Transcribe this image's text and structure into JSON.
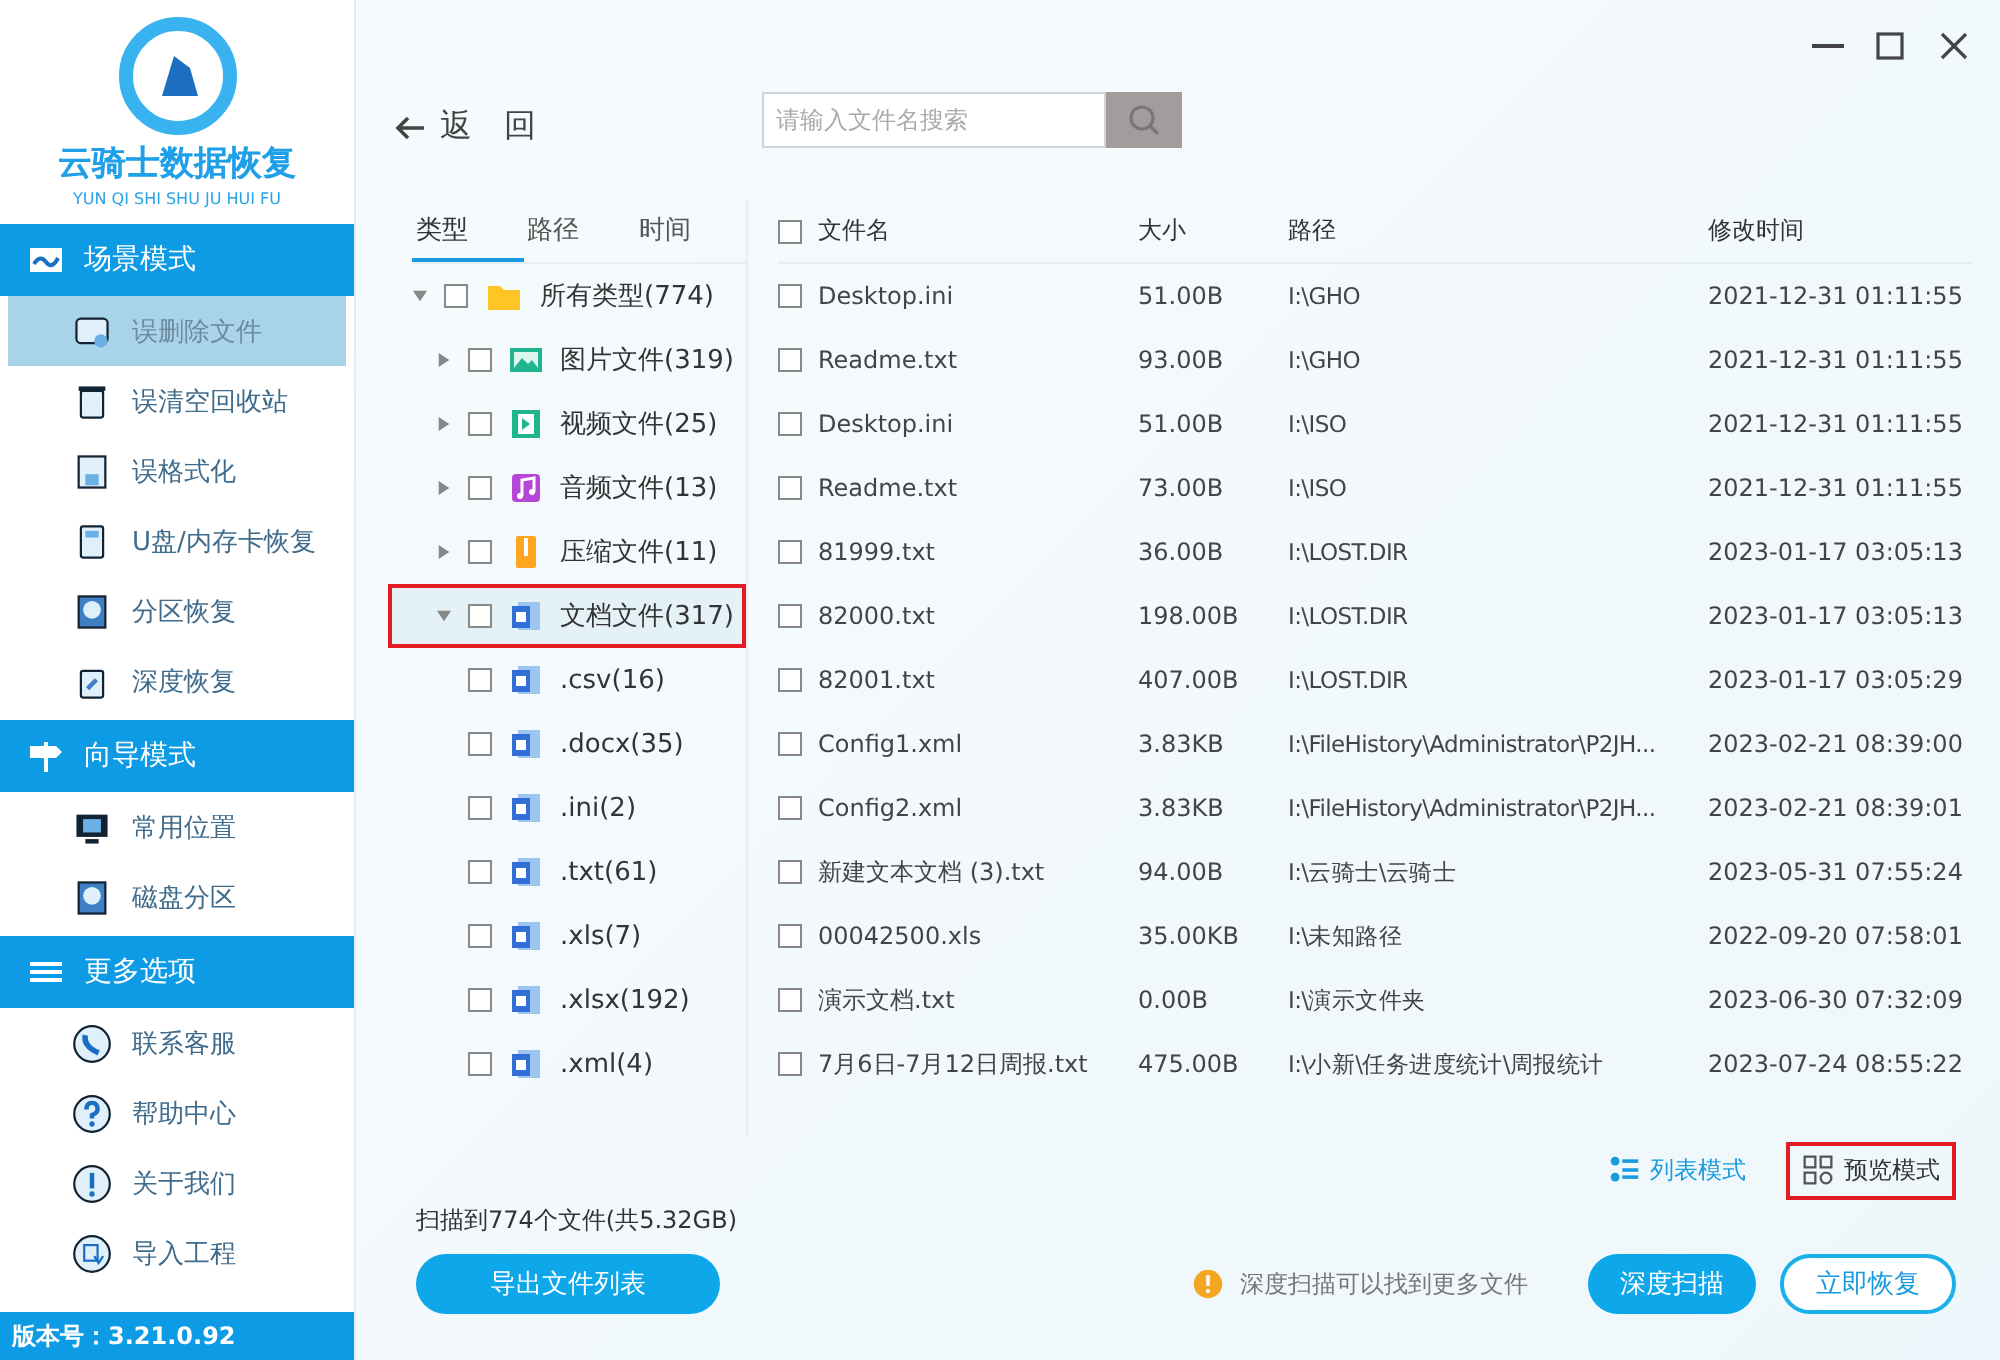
{
  "sidebar": {
    "logo": {
      "title": "云骑士数据恢复",
      "subtitle": "YUN QI SHI SHU JU HUI FU"
    },
    "sections": [
      {
        "title": "场景模式",
        "items": [
          {
            "label": "误删除文件",
            "selected": true
          },
          {
            "label": "误清空回收站",
            "selected": false
          },
          {
            "label": "误格式化",
            "selected": false
          },
          {
            "label": "U盘/内存卡恢复",
            "selected": false
          },
          {
            "label": "分区恢复",
            "selected": false
          },
          {
            "label": "深度恢复",
            "selected": false
          }
        ]
      },
      {
        "title": "向导模式",
        "items": [
          {
            "label": "常用位置",
            "selected": false
          },
          {
            "label": "磁盘分区",
            "selected": false
          }
        ]
      },
      {
        "title": "更多选项",
        "items": [
          {
            "label": "联系客服",
            "selected": false
          },
          {
            "label": "帮助中心",
            "selected": false
          },
          {
            "label": "关于我们",
            "selected": false
          },
          {
            "label": "导入工程",
            "selected": false
          }
        ]
      }
    ],
    "version": "版本号：3.21.0.92"
  },
  "toolbar": {
    "back_arrow": "返",
    "back_label": "回",
    "search": {
      "placeholder": "请输入文件名搜索"
    }
  },
  "filter_tabs": [
    {
      "label": "类型",
      "selected": true
    },
    {
      "label": "路径",
      "selected": false
    },
    {
      "label": "时间",
      "selected": false
    }
  ],
  "tree": {
    "label": "所有类型(774)",
    "kind": "folder",
    "checked": false,
    "expanded": true,
    "highlighted": false,
    "children": [
      {
        "label": "图片文件(319)",
        "kind": "image",
        "checked": false,
        "expanded": false,
        "highlighted": false
      },
      {
        "label": "视频文件(25)",
        "kind": "video",
        "checked": false,
        "expanded": false,
        "highlighted": false
      },
      {
        "label": "音频文件(13)",
        "kind": "audio",
        "checked": false,
        "expanded": false,
        "highlighted": false
      },
      {
        "label": "压缩文件(11)",
        "kind": "archive",
        "checked": false,
        "expanded": false,
        "highlighted": false
      },
      {
        "label": "文档文件(317)",
        "kind": "document",
        "checked": false,
        "expanded": true,
        "highlighted": true,
        "children": [
          {
            "label": ".csv(16)",
            "kind": "document",
            "checked": false,
            "highlighted": false
          },
          {
            "label": ".docx(35)",
            "kind": "document",
            "checked": false,
            "highlighted": false
          },
          {
            "label": ".ini(2)",
            "kind": "document",
            "checked": false,
            "highlighted": false
          },
          {
            "label": ".txt(61)",
            "kind": "document",
            "checked": false,
            "highlighted": false
          },
          {
            "label": ".xls(7)",
            "kind": "document",
            "checked": false,
            "highlighted": false
          },
          {
            "label": ".xlsx(192)",
            "kind": "document",
            "checked": false,
            "highlighted": false
          },
          {
            "label": ".xml(4)",
            "kind": "document",
            "checked": false,
            "highlighted": false
          }
        ]
      }
    ]
  },
  "table": {
    "select_all_checked": false,
    "columns": [
      "文件名",
      "大小",
      "路径",
      "修改时间"
    ],
    "rows": [
      {
        "checked": false,
        "cells": [
          "Desktop.ini",
          "51.00B",
          "I:\\GHO",
          "2021-12-31 01:11:55"
        ]
      },
      {
        "checked": false,
        "cells": [
          "Readme.txt",
          "93.00B",
          "I:\\GHO",
          "2021-12-31 01:11:55"
        ]
      },
      {
        "checked": false,
        "cells": [
          "Desktop.ini",
          "51.00B",
          "I:\\ISO",
          "2021-12-31 01:11:55"
        ]
      },
      {
        "checked": false,
        "cells": [
          "Readme.txt",
          "73.00B",
          "I:\\ISO",
          "2021-12-31 01:11:55"
        ]
      },
      {
        "checked": false,
        "cells": [
          "81999.txt",
          "36.00B",
          "I:\\LOST.DIR",
          "2023-01-17 03:05:13"
        ]
      },
      {
        "checked": false,
        "cells": [
          "82000.txt",
          "198.00B",
          "I:\\LOST.DIR",
          "2023-01-17 03:05:13"
        ]
      },
      {
        "checked": false,
        "cells": [
          "82001.txt",
          "407.00B",
          "I:\\LOST.DIR",
          "2023-01-17 03:05:29"
        ]
      },
      {
        "checked": false,
        "cells": [
          "Config1.xml",
          "3.83KB",
          "I:\\FileHistory\\Administrator\\P2JH...",
          "2023-02-21 08:39:00"
        ]
      },
      {
        "checked": false,
        "cells": [
          "Config2.xml",
          "3.83KB",
          "I:\\FileHistory\\Administrator\\P2JH...",
          "2023-02-21 08:39:01"
        ]
      },
      {
        "checked": false,
        "cells": [
          "新建文本文档 (3).txt",
          "94.00B",
          "I:\\云骑士\\云骑士",
          "2023-05-31 07:55:24"
        ]
      },
      {
        "checked": false,
        "cells": [
          "00042500.xls",
          "35.00KB",
          "I:\\未知路径",
          "2022-09-20 07:58:01"
        ]
      },
      {
        "checked": false,
        "cells": [
          "演示文档.txt",
          "0.00B",
          "I:\\演示文件夹",
          "2023-06-30 07:32:09"
        ]
      },
      {
        "checked": false,
        "cells": [
          "7月6日-7月12日周报.txt",
          "475.00B",
          "I:\\小新\\任务进度统计\\周报统计",
          "2023-07-24 08:55:22"
        ]
      }
    ]
  },
  "view_modes": [
    {
      "label": "列表模式",
      "kind": "list",
      "selected": true,
      "highlighted": false
    },
    {
      "label": "预览模式",
      "kind": "grid",
      "selected": false,
      "highlighted": true
    }
  ],
  "scan_summary": "扫描到774个文件(共5.32GB)",
  "export_button": "导出文件列表",
  "hint": "深度扫描可以找到更多文件",
  "deep_scan_button": "深度扫描",
  "recover_button": "立即恢复"
}
